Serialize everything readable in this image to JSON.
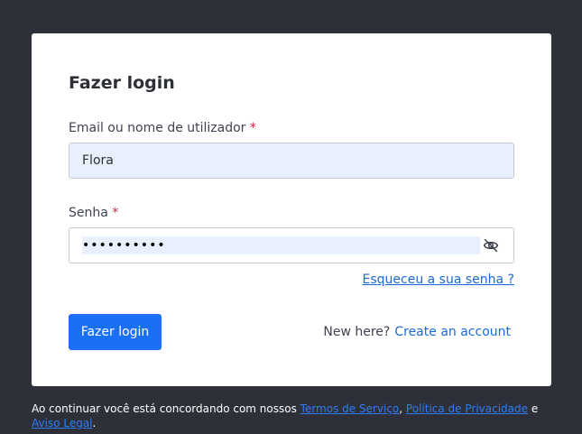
{
  "login": {
    "title": "Fazer login",
    "email_label": "Email ou nome de utilizador",
    "required_mark": "*",
    "email_value": "Flora",
    "password_label": "Senha",
    "password_value": "••••••••••",
    "toggle_visibility_icon": "eye-slash-icon",
    "forgot_password": "Esqueceu a sua senha ?",
    "submit_label": "Fazer login",
    "new_here": "New here?",
    "create_account": "Create an account"
  },
  "footer": {
    "prefix": "Ao continuar você está concordando com nossos ",
    "terms": "Termos de Serviço",
    "comma": ", ",
    "privacy": "Política de Privacidade",
    "and": " e ",
    "legal": "Aviso Legal",
    "period": "."
  },
  "colors": {
    "background": "#2d3038",
    "card": "#ffffff",
    "primary": "#1a6ff2",
    "link": "#1b6ad4",
    "required": "#d6213f",
    "autofill": "#e8f0fd"
  }
}
